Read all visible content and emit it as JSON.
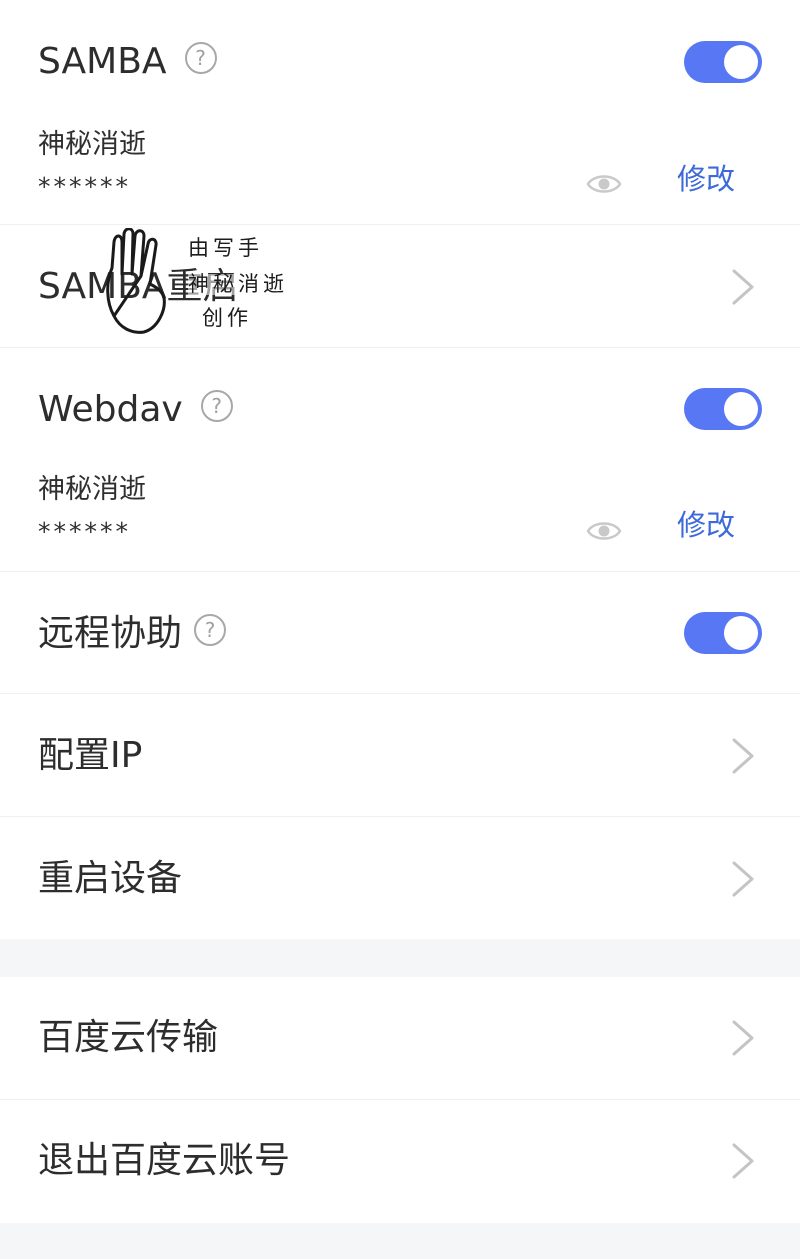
{
  "samba": {
    "title": "SAMBA",
    "help_icon": "question-circle-icon",
    "enabled": true,
    "username": "神秘消逝",
    "password": "******",
    "modify_label": "修改"
  },
  "samba_restart": {
    "title": "SAMBA重启"
  },
  "webdav": {
    "title": "Webdav",
    "help_icon": "question-circle-icon",
    "enabled": true,
    "username": "神秘消逝",
    "password": "******",
    "modify_label": "修改"
  },
  "remote_assist": {
    "title": "远程协助",
    "help_icon": "question-circle-icon",
    "enabled": true
  },
  "configure_ip": {
    "title": "配置IP"
  },
  "reboot_device": {
    "title": "重启设备"
  },
  "baidu_transfer": {
    "title": "百度云传输"
  },
  "baidu_logout": {
    "title": "退出百度云账号"
  },
  "watermark": {
    "line1": "由写手",
    "line2": "神秘消逝",
    "line3": "创作"
  },
  "colors": {
    "accent": "#5877f5",
    "link": "#3d6ad8",
    "background": "#f5f6f8"
  }
}
